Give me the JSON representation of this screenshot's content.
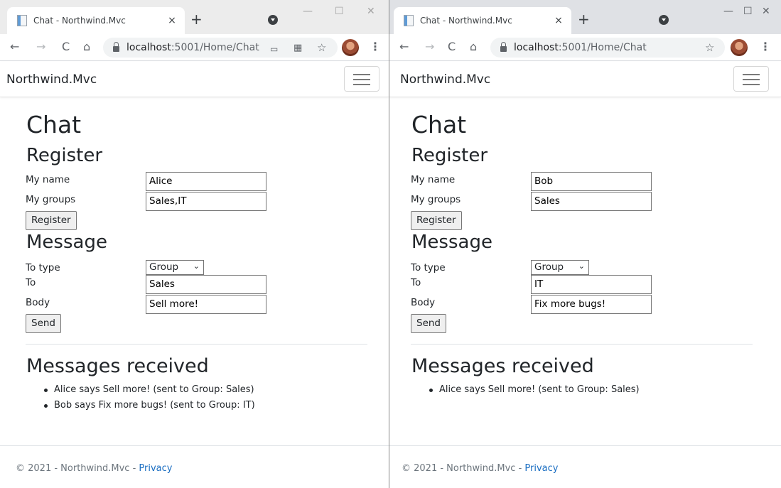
{
  "windows": [
    {
      "tab_title": "Chat - Northwind.Mvc",
      "url_host": "localhost",
      "url_path": ":5001/Home/Chat",
      "brand": "Northwind.Mvc",
      "title": "Chat",
      "register_heading": "Register",
      "name_label": "My name",
      "name_value": "Alice",
      "groups_label": "My groups",
      "groups_value": "Sales,IT",
      "register_button": "Register",
      "message_heading": "Message",
      "to_type_label": "To type",
      "to_type_value": "Group",
      "to_label": "To",
      "to_value": "Sales",
      "body_label": "Body",
      "body_value": "Sell more!",
      "send_button": "Send",
      "received_heading": "Messages received",
      "messages": [
        "Alice says Sell more! (sent to Group: Sales)",
        "Bob says Fix more bugs! (sent to Group: IT)"
      ],
      "footer_text": "© 2021 - Northwind.Mvc - ",
      "footer_link": "Privacy"
    },
    {
      "tab_title": "Chat - Northwind.Mvc",
      "url_host": "localhost",
      "url_path": ":5001/Home/Chat",
      "brand": "Northwind.Mvc",
      "title": "Chat",
      "register_heading": "Register",
      "name_label": "My name",
      "name_value": "Bob",
      "groups_label": "My groups",
      "groups_value": "Sales",
      "register_button": "Register",
      "message_heading": "Message",
      "to_type_label": "To type",
      "to_type_value": "Group",
      "to_label": "To",
      "to_value": "IT",
      "body_label": "Body",
      "body_value": "Fix more bugs!",
      "send_button": "Send",
      "received_heading": "Messages received",
      "messages": [
        "Alice says Sell more! (sent to Group: Sales)"
      ],
      "footer_text": "© 2021 - Northwind.Mvc - ",
      "footer_link": "Privacy"
    }
  ],
  "icons": {
    "back": "←",
    "forward": "→",
    "reload": "C",
    "home": "⌂",
    "close_tab": "×",
    "new_tab": "+",
    "minimize": "—",
    "maximize": "☐",
    "close_window": "✕",
    "star": "☆",
    "menu": "⋮",
    "select_chevron": "⌄"
  }
}
